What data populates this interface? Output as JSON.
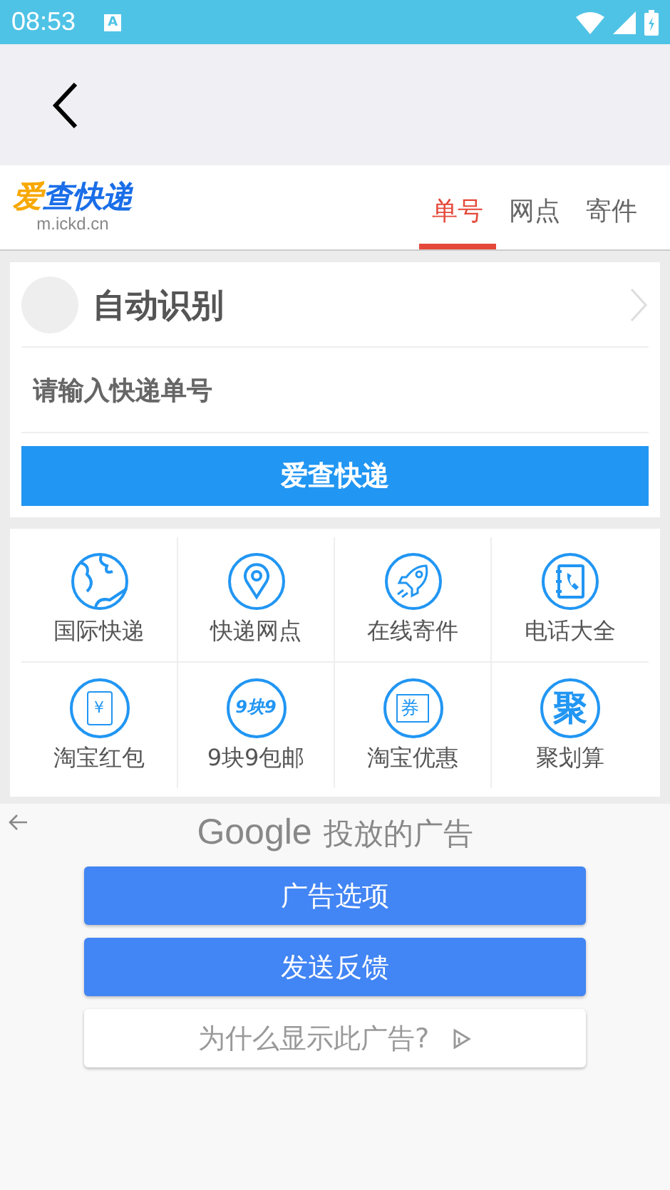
{
  "status_bar": {
    "time": "08:53",
    "notification": "A"
  },
  "header": {
    "logo": {
      "title": "爱查快递",
      "subtitle": "m.ickd.cn"
    },
    "tabs": [
      {
        "label": "单号",
        "selected": true
      },
      {
        "label": "网点",
        "selected": false
      },
      {
        "label": "寄件",
        "selected": false
      }
    ]
  },
  "query": {
    "carrier": "自动识别",
    "input": {
      "placeholder": "请输入快递单号"
    },
    "submit": "爱查快递"
  },
  "services": [
    {
      "kind": "globe",
      "label": "国际快递"
    },
    {
      "kind": "pin",
      "label": "快递网点"
    },
    {
      "kind": "rocket",
      "label": "在线寄件"
    },
    {
      "kind": "phonebook",
      "label": "电话大全"
    },
    {
      "kind": "envelope",
      "icon_text": "¥",
      "label": "淘宝红包"
    },
    {
      "kind": "text",
      "icon_text": "9块9",
      "label": "9块9包邮"
    },
    {
      "kind": "coupon",
      "icon_text": "券",
      "label": "淘宝优惠"
    },
    {
      "kind": "bigtext",
      "icon_text": "聚",
      "label": "聚划算"
    }
  ],
  "ad": {
    "brand": "Google",
    "title": "投放的广告",
    "buttons": [
      {
        "label": "广告选项",
        "kind": "primary"
      },
      {
        "label": "发送反馈",
        "kind": "primary"
      },
      {
        "label": "为什么显示此广告?",
        "kind": "secondary"
      }
    ]
  }
}
